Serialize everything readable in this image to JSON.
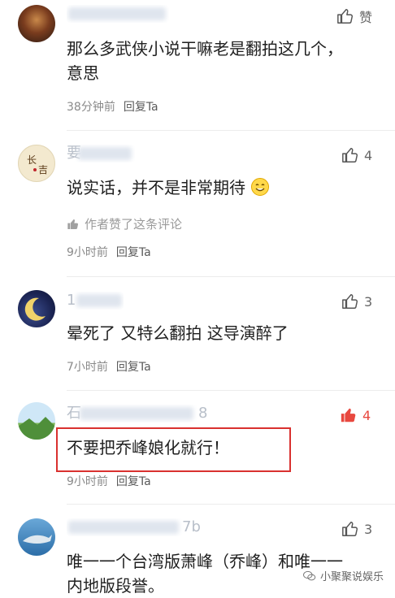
{
  "comments": [
    {
      "text": "那么多武侠小说干嘛老是翻拍这几个，",
      "text2": "意思",
      "time": "38分钟前",
      "reply": "回复Ta",
      "likes": "赞"
    },
    {
      "username_partial": "要",
      "text": "说实话，并不是非常期待",
      "author_liked": "作者赞了这条评论",
      "time": "9小时前",
      "reply": "回复Ta",
      "likes": "4"
    },
    {
      "username_partial": "1",
      "text": "晕死了 又特么翻拍  这导演醉了",
      "time": "7小时前",
      "reply": "回复Ta",
      "likes": "3"
    },
    {
      "username_partial_start": "石",
      "username_partial_end": "8",
      "text": "不要把乔峰娘化就行！",
      "time": "9小时前",
      "reply": "回复Ta",
      "likes": "4"
    },
    {
      "username_partial_end": "7b",
      "text": "唯一一个台湾版萧峰（乔峰）和唯一一",
      "text2": "内地版段誉。",
      "likes": "3"
    }
  ],
  "watermark": "小聚聚说娱乐",
  "colors": {
    "like_active": "#e8483f",
    "highlight": "#d9312f"
  }
}
